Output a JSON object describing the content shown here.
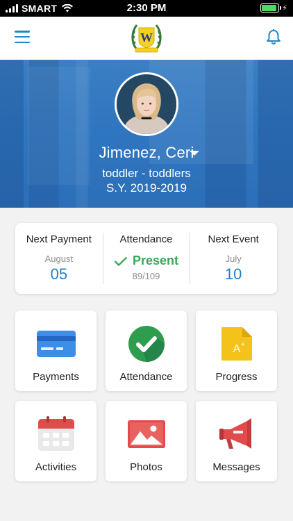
{
  "status_bar": {
    "carrier": "SMART",
    "time": "2:30 PM",
    "battery_level": 0.9
  },
  "header": {
    "menu_icon": "hamburger-icon",
    "logo_icon": "school-crest-logo",
    "bell_icon": "bell-icon",
    "accent_color": "#1e88c9"
  },
  "student": {
    "name": "Jimenez, Ceri",
    "grade": "toddler - toddlers",
    "school_year": "S.Y. 2019-2019"
  },
  "summary": {
    "payment": {
      "title": "Next Payment",
      "month": "August",
      "day": "05"
    },
    "attendance": {
      "title": "Attendance",
      "status": "Present",
      "count": "89/109",
      "status_color": "#3aa757"
    },
    "event": {
      "title": "Next Event",
      "month": "July",
      "day": "10"
    }
  },
  "tiles": [
    {
      "label": "Payments",
      "icon": "credit-card-icon"
    },
    {
      "label": "Attendance",
      "icon": "check-circle-icon"
    },
    {
      "label": "Progress",
      "icon": "report-card-icon"
    },
    {
      "label": "Activities",
      "icon": "calendar-icon"
    },
    {
      "label": "Photos",
      "icon": "photo-icon"
    },
    {
      "label": "Messages",
      "icon": "megaphone-icon"
    }
  ]
}
